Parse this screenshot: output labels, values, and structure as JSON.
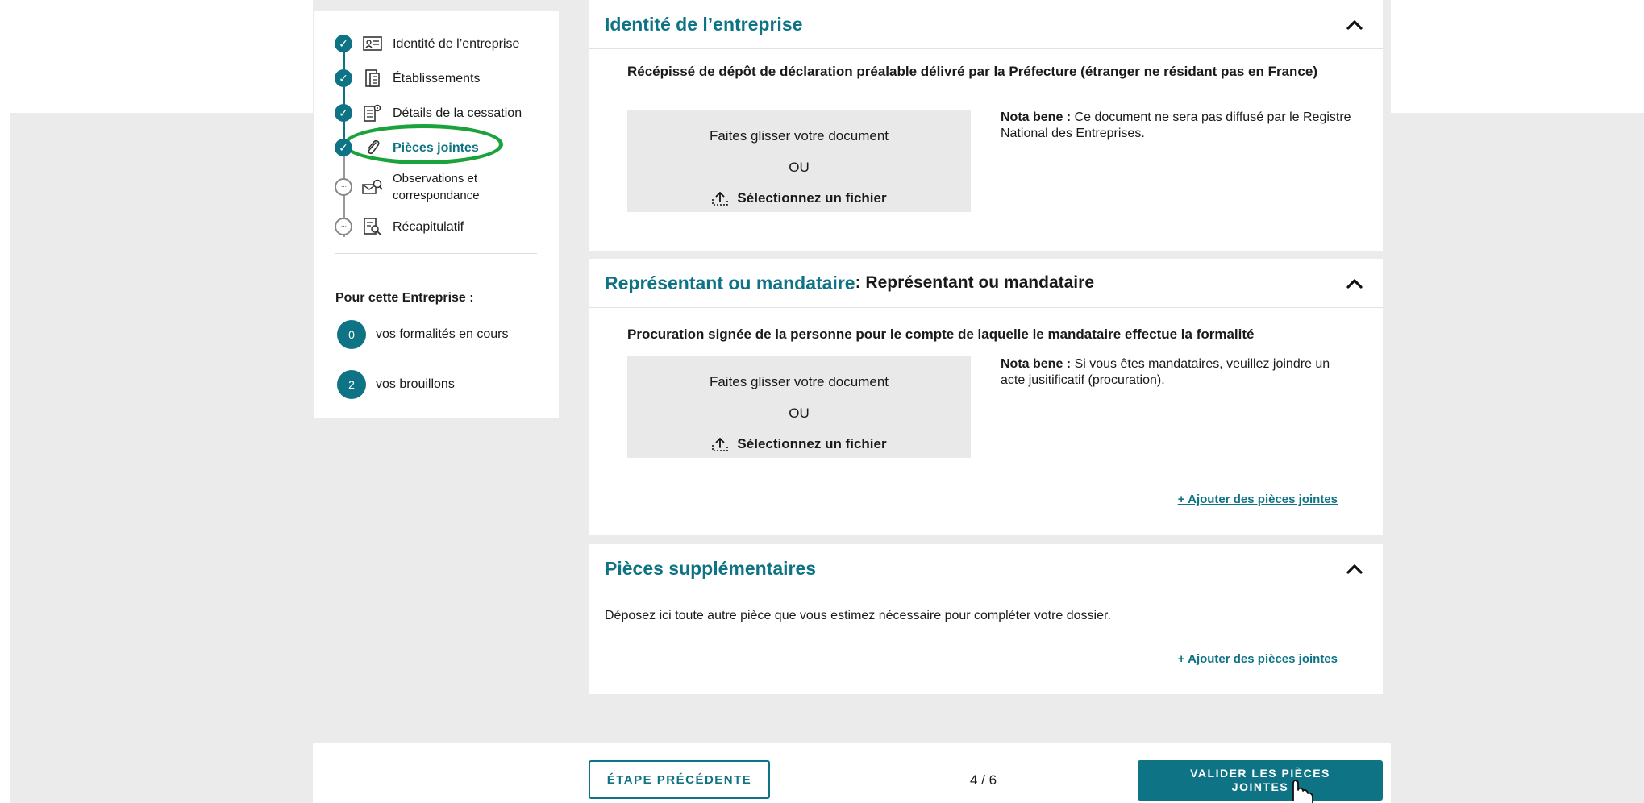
{
  "sidebar": {
    "steps": [
      {
        "label": "Identité de l’entreprise",
        "state": "done",
        "icon": "id-card-icon"
      },
      {
        "label": "Établissements",
        "state": "done",
        "icon": "building-doc-icon"
      },
      {
        "label": "Détails de la cessation",
        "state": "done",
        "icon": "doc-settings-icon"
      },
      {
        "label": "Pièces jointes",
        "state": "active",
        "icon": "paperclip-icon"
      },
      {
        "label_line1": "Observations et",
        "label_line2": "correspondance",
        "state": "todo",
        "icon": "envelope-search-icon"
      },
      {
        "label": "Récapitulatif",
        "state": "todo",
        "icon": "doc-search-icon"
      }
    ],
    "company_heading": "Pour cette Entreprise :",
    "counts": [
      {
        "value": "0",
        "label": "vos formalités en cours"
      },
      {
        "value": "2",
        "label": "vos brouillons"
      }
    ]
  },
  "panels": {
    "identity": {
      "title": "Identité de l’entreprise",
      "doc_title": "Récépissé de dépôt de déclaration préalable délivré par la Préfecture (étranger ne résidant pas en France)",
      "nota_label": "Nota bene :",
      "nota_text": " Ce document ne sera pas diffusé par le Registre National des Entreprises."
    },
    "representative": {
      "title": "Représentant ou mandataire",
      "title_sub": " : Représentant ou mandataire",
      "doc_title": "Procuration signée de la personne pour le compte de laquelle le mandataire effectue la formalité",
      "nota_label": "Nota bene :",
      "nota_text": " Si vous êtes mandataires, veuillez joindre un acte jusitificatif (procuration).",
      "add_link": "+ Ajouter des pièces jointes"
    },
    "extra": {
      "title": "Pièces supplémentaires",
      "description": "Déposez ici toute autre pièce que vous estimez nécessaire pour compléter votre dossier.",
      "add_link": "+ Ajouter des pièces jointes"
    }
  },
  "dropzone": {
    "drag_text": "Faites glisser votre document",
    "or_text": "OU",
    "select_text": "Sélectionnez un fichier"
  },
  "footer": {
    "prev_button": "ÉTAPE PRÉCÉDENTE",
    "pager": "4 / 6",
    "next_line1": "VALIDER LES PIÈCES",
    "next_line2": "JOINTES"
  },
  "colors": {
    "accent": "#0e7385",
    "highlight": "#1aa33a"
  }
}
